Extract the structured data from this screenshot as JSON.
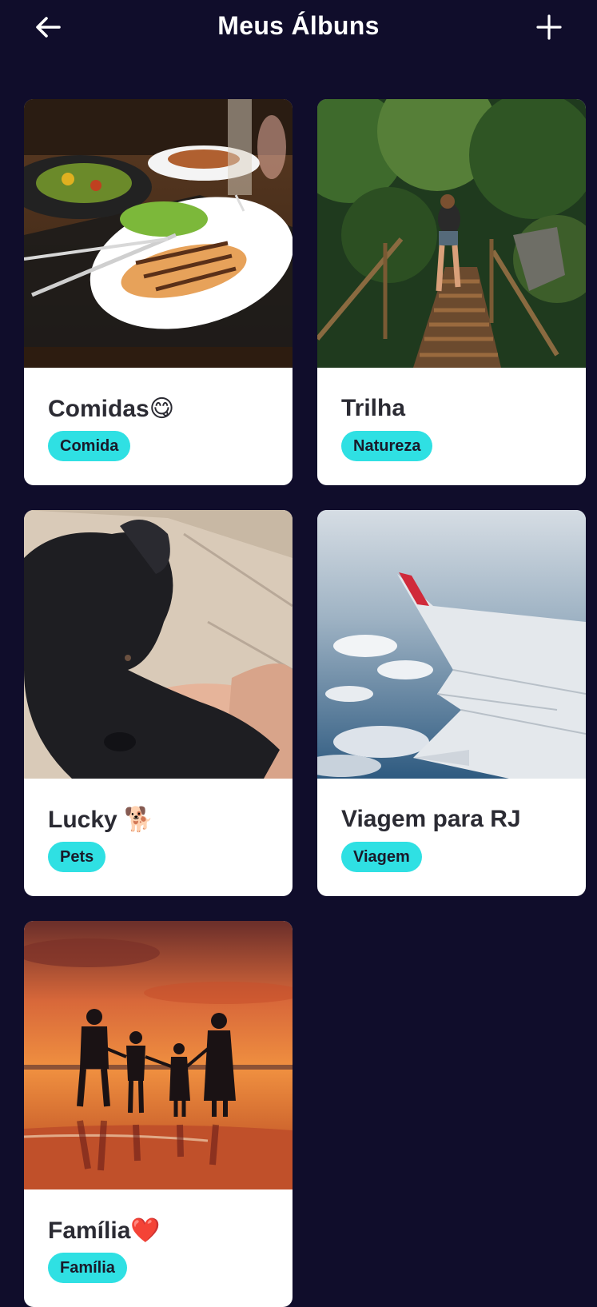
{
  "header": {
    "title": "Meus Álbuns",
    "back_icon": "arrow-left-icon",
    "add_icon": "plus-icon"
  },
  "albums": [
    {
      "title": "Comidas😋",
      "tag": "Comida",
      "image": "food-plate-photo"
    },
    {
      "title": "Trilha",
      "tag": "Natureza",
      "image": "forest-trail-photo"
    },
    {
      "title": "Lucky 🐕",
      "tag": "Pets",
      "image": "black-dog-photo"
    },
    {
      "title": "Viagem para RJ",
      "tag": "Viagem",
      "image": "airplane-wing-photo"
    },
    {
      "title": "Família❤️",
      "tag": "Família",
      "image": "family-sunset-photo"
    }
  ],
  "colors": {
    "background": "#100d2b",
    "card": "#ffffff",
    "tag": "#2fe0e3",
    "title_text": "#2b2b33"
  }
}
